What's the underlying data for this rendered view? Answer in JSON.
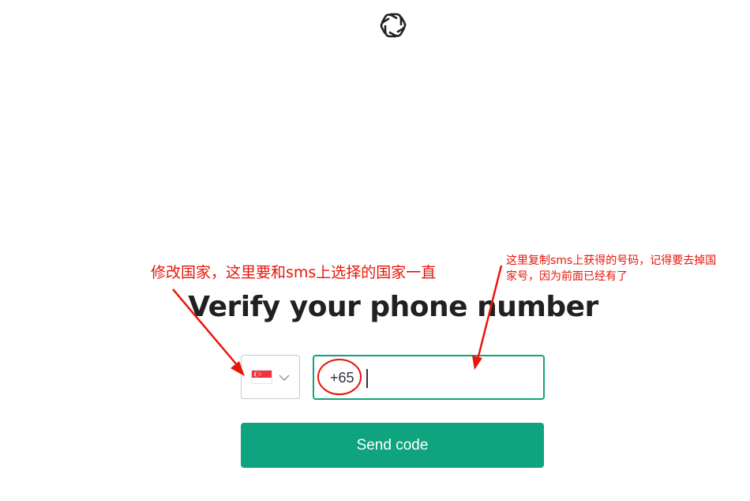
{
  "logo": {
    "icon": "openai-logo-icon"
  },
  "heading": {
    "title": "Verify your phone number"
  },
  "country_select": {
    "selected_country": "Singapore",
    "flag_icon": "singapore-flag-icon",
    "chevron_icon": "chevron-down-icon"
  },
  "phone_input": {
    "dial_code": "+65",
    "value": ""
  },
  "send_button": {
    "label": "Send code"
  },
  "annotations": {
    "left_note": "修改国家，这里要和sms上选择的国家一直",
    "right_note_line1": "这里复制sms上获得的号码，记得要去掉国",
    "right_note_line2": "家号，因为前面已经有了"
  },
  "colors": {
    "accent": "#10a37f",
    "annotation": "#e8150a",
    "text": "#202123"
  }
}
